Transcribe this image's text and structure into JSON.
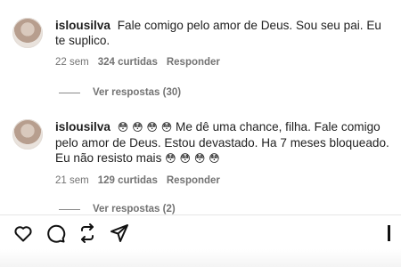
{
  "comments": [
    {
      "username": "islousilva",
      "emojis_before": "",
      "text": "Fale comigo pelo amor de Deus. Sou seu pai. Eu te suplico.",
      "time": "22 sem",
      "likes": "324 curtidas",
      "reply_label": "Responder",
      "view_replies": "Ver respostas (30)"
    },
    {
      "username": "islousilva",
      "emojis_before": "😳 😳 😳 😳",
      "text": "Me dê uma chance, filha. Fale comigo pelo amor de Deus. Estou devastado. Ha 7 meses bloqueado. Eu não resisto mais",
      "emojis_after": "😳 😳 😳 😳",
      "time": "21 sem",
      "likes": "129 curtidas",
      "reply_label": "Responder",
      "view_replies": "Ver respostas (2)"
    }
  ],
  "actions": {
    "like_icon": "heart-icon",
    "comment_icon": "comment-icon",
    "share_icon": "repost-icon",
    "send_icon": "send-icon",
    "save_icon": "bookmark-icon"
  }
}
